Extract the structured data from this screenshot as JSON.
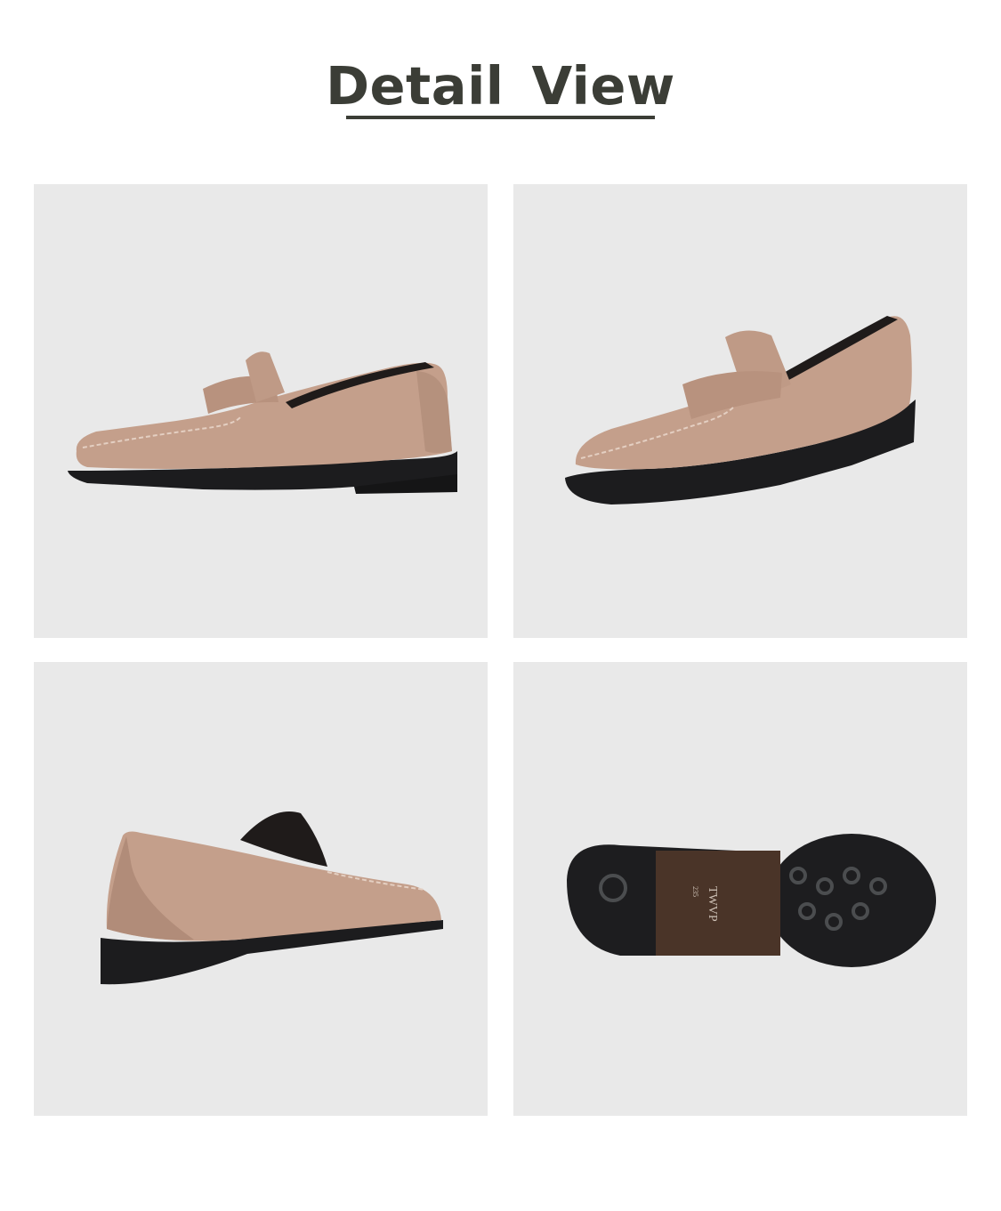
{
  "heading": {
    "title": "Detail View"
  },
  "views": [
    {
      "label": "side-view"
    },
    {
      "label": "three-quarter-view"
    },
    {
      "label": "back-view"
    },
    {
      "label": "sole-view"
    }
  ],
  "sole_stamp": {
    "brand": "TWVP",
    "size": "235"
  },
  "colors": {
    "background": "#ffffff",
    "panel": "#e9e9e9",
    "title": "#3b3d36",
    "suede": "#c49f8b",
    "suede_shadow": "#a98572",
    "sole": "#1d1d1f",
    "heel_wood": "#4a3428"
  }
}
